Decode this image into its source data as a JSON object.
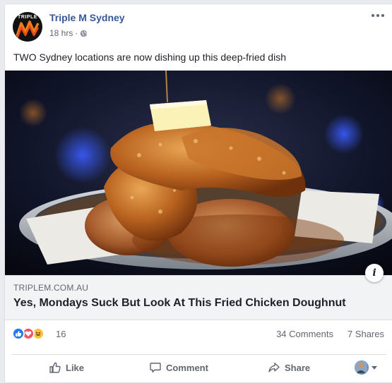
{
  "post": {
    "page_name": "Triple M Sydney",
    "avatar_text": "TRIPLE",
    "timestamp": "18 hrs",
    "separator": "·",
    "privacy_icon": "globe-icon",
    "text": "TWO Sydney locations are now dishing up this deep-fried dish"
  },
  "link": {
    "domain": "TRIPLEM.COM.AU",
    "title": "Yes, Mondays Suck But Look At This Fried Chicken Doughnut",
    "image_description_icon": "info-icon"
  },
  "engagement": {
    "reaction_icons": [
      "like-reaction-icon",
      "love-reaction-icon",
      "haha-reaction-icon"
    ],
    "reaction_count": "16",
    "comments": "34 Comments",
    "shares": "7 Shares"
  },
  "actions": {
    "like_label": "Like",
    "comment_label": "Comment",
    "share_label": "Share"
  },
  "colors": {
    "page_name": "#365899",
    "like_reaction": "#2078f4",
    "love_reaction": "#f25268",
    "haha_reaction": "#f7c33d",
    "secondary_text": "#606770"
  }
}
